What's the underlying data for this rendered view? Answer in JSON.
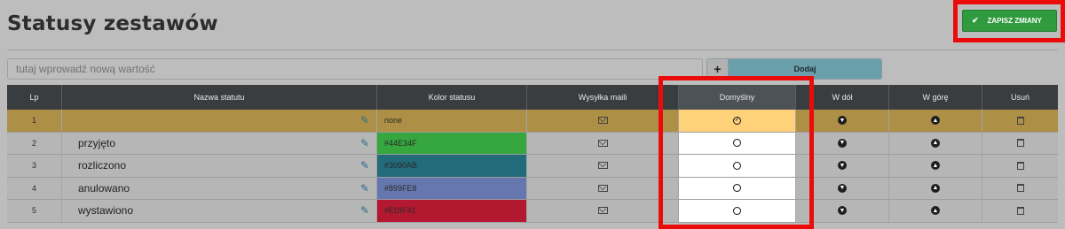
{
  "page": {
    "title": "Statusy zestawów",
    "save_label": "ZAPISZ ZMIANY"
  },
  "new_value": {
    "placeholder": "tutaj wprowadź nową wartość",
    "plus_label": "+",
    "add_label": "Dodaj"
  },
  "table": {
    "headers": [
      "Lp",
      "Nazwa statutu",
      "Kolor statusu",
      "Wysyłka maili",
      "Domyślny",
      "W dół",
      "W górę",
      "Usuń"
    ],
    "rows": [
      {
        "lp": "1",
        "name": "",
        "color": "none",
        "color_hex": "",
        "default": true
      },
      {
        "lp": "2",
        "name": "przyjęto",
        "color": "#44E34F",
        "color_hex": "#36a63e",
        "default": false
      },
      {
        "lp": "3",
        "name": "rozliczono",
        "color": "#3090AB",
        "color_hex": "#216b7a",
        "default": false
      },
      {
        "lp": "4",
        "name": "anulowano",
        "color": "#899FE8",
        "color_hex": "#6677b0",
        "default": false
      },
      {
        "lp": "5",
        "name": "wystawiono",
        "color": "#EDIF41",
        "color_hex": "#b21830",
        "default": false
      }
    ]
  },
  "colors": {
    "highlight": "#ec0b0b",
    "save_button": "#2f9a3e",
    "add_button": "#6b9fac",
    "selected_row": "#ad8f45",
    "header_bg": "#3a3d40"
  }
}
